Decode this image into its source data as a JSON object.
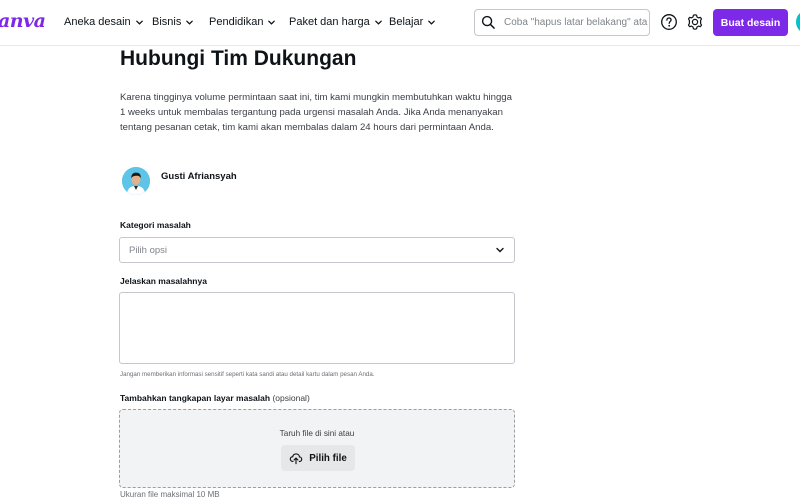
{
  "header": {
    "logo": "anva",
    "nav": [
      {
        "label": "Aneka desain"
      },
      {
        "label": "Bisnis"
      },
      {
        "label": "Pendidikan"
      },
      {
        "label": "Paket dan harga"
      },
      {
        "label": "Belajar"
      }
    ],
    "search_placeholder": "Coba \"hapus latar belakang\" ata",
    "cta_label": "Buat desain",
    "icons": [
      "search-icon",
      "help-icon",
      "gear-icon",
      "chevron-down-icon"
    ]
  },
  "page": {
    "title": "Hubungi Tim Dukungan",
    "intro": "Karena tingginya volume permintaan saat ini, tim kami mungkin membutuhkan waktu hingga 1 weeks untuk membalas tergantung pada urgensi masalah Anda. Jika Anda menanyakan tentang pesanan cetak, tim kami akan membalas dalam 24 hours dari permintaan Anda.",
    "agent_name": "Gusti Afriansyah"
  },
  "form": {
    "category_label": "Kategori masalah",
    "category_selected": "Pilih opsi",
    "describe_label": "Jelaskan masalahnya",
    "describe_value": "",
    "hint": "Jangan memberikan informasi sensitif seperti kata sandi atau detail kartu dalam pesan Anda.",
    "screenshot_label": "Tambahkan tangkapan layar masalah",
    "screenshot_optional": "(opsional)",
    "drop_text": "Taruh file di sini atau",
    "pick_label": "Pilih file",
    "max_size": "Ukuran file maksimal 10 MB"
  },
  "colors": {
    "brand": "#7d2ae8",
    "text": "#0e1318",
    "border": "#c4c7cc",
    "dropzone_bg": "#f2f3f5"
  }
}
